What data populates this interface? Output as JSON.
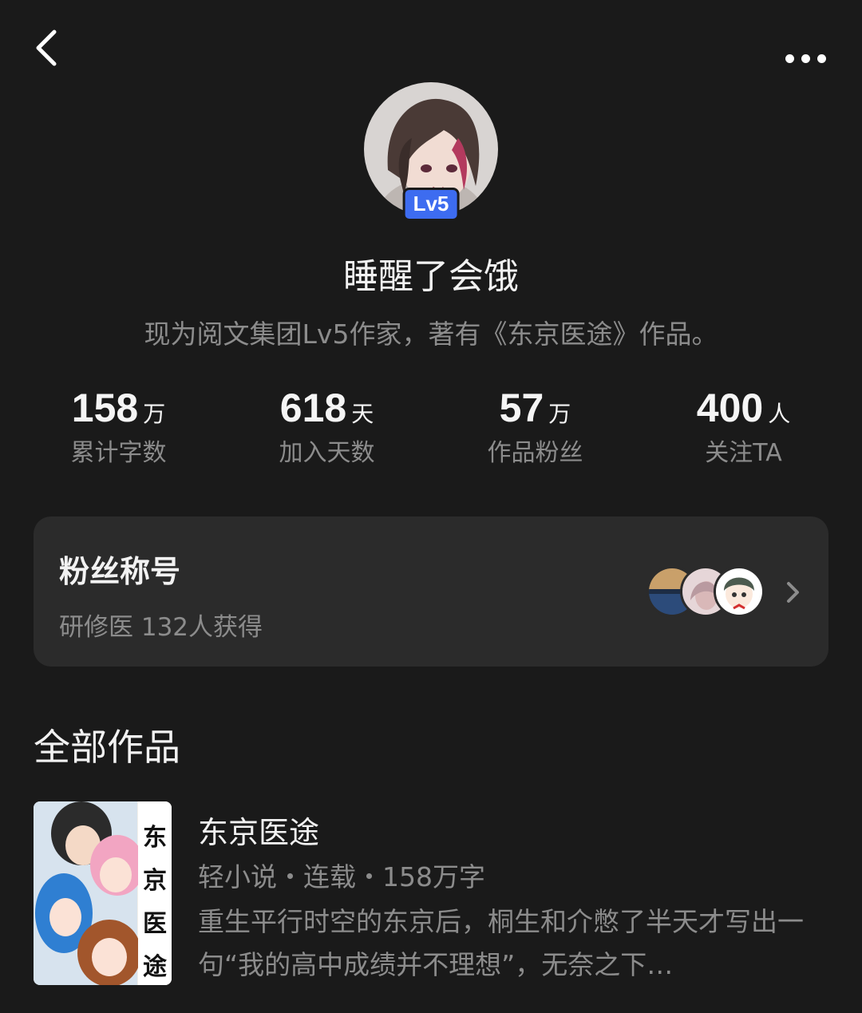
{
  "header": {
    "back_icon": "chevron-left-icon",
    "more_icon": "more-horizontal-icon"
  },
  "profile": {
    "level_badge": "Lv5",
    "name": "睡醒了会饿",
    "bio": "现为阅文集团Lv5作家，著有《东京医途》作品。",
    "badge_color": "#3d6cf0"
  },
  "stats": [
    {
      "value": "158",
      "unit": "万",
      "label": "累计字数"
    },
    {
      "value": "618",
      "unit": "天",
      "label": "加入天数"
    },
    {
      "value": "57",
      "unit": "万",
      "label": "作品粉丝"
    },
    {
      "value": "400",
      "unit": "人",
      "label": "关注TA"
    }
  ],
  "fan_title_card": {
    "title": "粉丝称号",
    "subtitle": "研修医 132人获得",
    "chevron_icon": "chevron-right-icon"
  },
  "works": {
    "section_title": "全部作品",
    "items": [
      {
        "title": "东京医途",
        "meta": "轻小说・连载・158万字",
        "description": "重生平行时空的东京后，桐生和介憋了半天才写出一句“我的高中成绩并不理想”，无奈之下…",
        "cover_title_chars": [
          "东",
          "京",
          "医",
          "途"
        ]
      }
    ]
  }
}
